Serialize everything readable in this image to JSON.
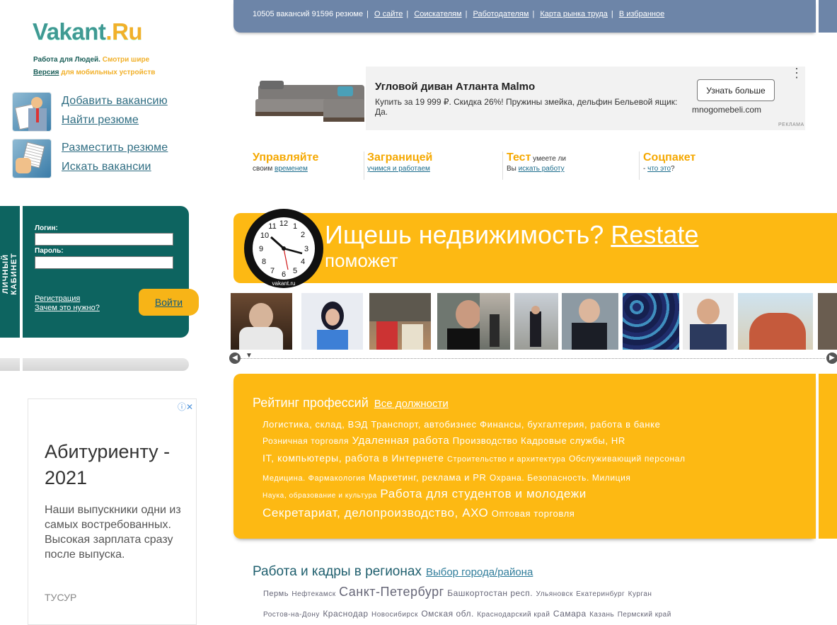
{
  "logo": {
    "main": "Vakant",
    "dot": ".Ru"
  },
  "tagline": {
    "part1": "Работа для Людей.",
    "part2": "Смотри шире"
  },
  "mobile": {
    "link": "Версия",
    "rest": "для мобильных устройств"
  },
  "side_links": {
    "add_vacancy": "Добавить вакансию",
    "find_resume": "Найти резюме",
    "post_resume": "Разместить резюме",
    "find_vacancies": "Искать вакансии"
  },
  "login": {
    "cabinet_label": "ЛИЧНЫЙ КАБИНЕТ",
    "login_label": "Логин:",
    "password_label": "Пароль:",
    "register": "Регистрация",
    "why": "Зачем это нужно?",
    "submit": "Войти"
  },
  "left_ad": {
    "title": "Абитуриенту - 2021",
    "text": "Наши выпускники одни из самых востребованных. Высокая зарплата сразу после выпуска.",
    "source": "ТУСУР"
  },
  "top_nav": {
    "stats": "10505 вакансий 91596 резюме",
    "items": [
      "О сайте",
      "Соискателям",
      "Работодателям",
      "Карта рынка труда",
      "В избранное"
    ]
  },
  "top_ad": {
    "title": "Угловой диван Атланта Malmo",
    "text": "Купить за 19 999 ₽. Скидка 26%! Пружины змейка, дельфин Бельевой ящик: Да.",
    "button": "Узнать больше",
    "domain": "mnogomebeli.com",
    "mark": "РЕКЛАМА"
  },
  "promos": [
    {
      "head": "Управляйте",
      "head_inline": "",
      "sub_pre": "своим ",
      "sub_link": "временем",
      "sub_post": ""
    },
    {
      "head": "Заграницей",
      "head_inline": "",
      "sub_pre": "",
      "sub_link": "учимся и работаем",
      "sub_post": ""
    },
    {
      "head": "Тест",
      "head_inline": " умеете ли",
      "sub_pre": "Вы ",
      "sub_link": "искать работу",
      "sub_post": ""
    },
    {
      "head": "Соцпакет",
      "head_inline": "",
      "sub_pre": "- ",
      "sub_link": "что это",
      "sub_post": "?"
    }
  ],
  "restate": {
    "line1": "Ищешь недвижимость?",
    "link": "Restate",
    "line2": "поможет",
    "clock_brand": "vakant.ru"
  },
  "rating": {
    "title": "Рейтинг профессий",
    "all_link": "Все должности",
    "tags": [
      "Логистика, склад, ВЭД",
      "Транспорт, автобизнес",
      "Финансы, бухгалтерия, работа в банке",
      "Розничная торговля",
      "Удаленная работа",
      "Производство",
      "Кадровые службы, HR",
      "IT, компьютеры, работа в Интернете",
      "Строительство и архитектура",
      "Обслуживающий персонал",
      "Медицина. Фармакология",
      "Маркетинг, реклама и PR",
      "Охрана. Безопасность. Милиция",
      "Наука, образование и культура",
      "Работа для студентов и молодежи",
      "Секретариат, делопроизводство, АХО",
      "Оптовая торговля"
    ]
  },
  "regions": {
    "title": "Работа и кадры в регионах",
    "link": "Выбор города/района",
    "cities": [
      "Пермь",
      "Нефтекамск",
      "Санкт-Петербург",
      "Башкортостан респ.",
      "Ульяновск",
      "Екатеринбург",
      "Курган",
      "Ростов-на-Дону",
      "Краснодар",
      "Новосибирск",
      "Омская обл.",
      "Краснодарский край",
      "Самара",
      "Казань",
      "Пермский край"
    ]
  },
  "colors": {
    "teal": "#0d6460",
    "nav": "#6d85a8",
    "orange": "#fdb913",
    "promo": "#f5a800"
  }
}
